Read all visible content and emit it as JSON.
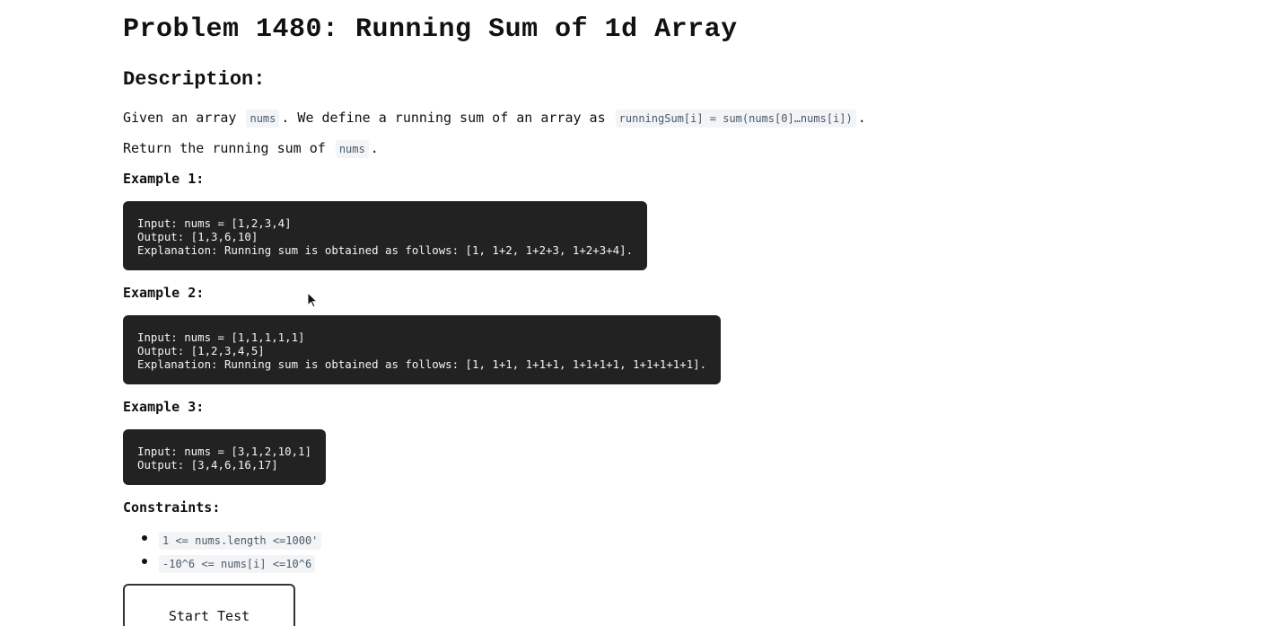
{
  "problem": {
    "title": "Problem 1480: Running Sum of 1d Array",
    "description_heading": "Description:",
    "line1": {
      "text_a": "Given an array",
      "code_a": "nums",
      "text_b": ". We define a running sum of an array as",
      "code_b": "runningSum[i] = sum(nums[0]…nums[i])",
      "text_c": "."
    },
    "line2": {
      "text_a": "Return the running sum of",
      "code_a": "nums",
      "text_b": "."
    }
  },
  "examples": [
    {
      "heading": "Example 1:",
      "input": "Input: nums = [1,2,3,4]",
      "output": "Output: [1,3,6,10]",
      "explanation": "Explanation: Running sum is obtained as follows: [1, 1+2, 1+2+3, 1+2+3+4]."
    },
    {
      "heading": "Example 2:",
      "input": "Input: nums = [1,1,1,1,1]",
      "output": "Output: [1,2,3,4,5]",
      "explanation": "Explanation: Running sum is obtained as follows: [1, 1+1, 1+1+1, 1+1+1+1, 1+1+1+1+1]."
    },
    {
      "heading": "Example 3:",
      "input": "Input: nums = [3,1,2,10,1]",
      "output": "Output: [3,4,6,16,17]"
    }
  ],
  "constraints": {
    "heading": "Constraints:",
    "items": [
      "1 <= nums.length <=1000'",
      "-10^6 <= nums[i] <=10^6"
    ]
  },
  "actions": {
    "start_label": "Start Test"
  },
  "colors": {
    "code_block_bg": "#222222",
    "inline_code_bg": "#f2f4f6",
    "inline_code_text": "#4a5a6a"
  }
}
